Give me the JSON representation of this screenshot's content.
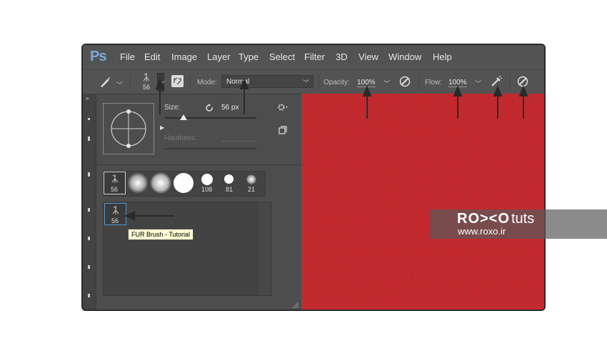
{
  "app": {
    "logo": "Ps"
  },
  "menu": [
    "File",
    "Edit",
    "Image",
    "Layer",
    "Type",
    "Select",
    "Filter",
    "3D",
    "View",
    "Window",
    "Help"
  ],
  "options": {
    "brush_size_preview": "56",
    "mode_label": "Mode:",
    "mode_value": "Normal",
    "opacity_label": "Opacity:",
    "opacity_value": "100%",
    "flow_label": "Flow:",
    "flow_value": "100%"
  },
  "brush_panel": {
    "size_label": "Size:",
    "size_value": "56 px",
    "hardness_label": "Hardness:",
    "size_slider_percent": 20,
    "presets": [
      {
        "label": "56",
        "kind": "fur"
      },
      {
        "label": "",
        "kind": "soft"
      },
      {
        "label": "",
        "kind": "soft"
      },
      {
        "label": "",
        "kind": "hard"
      },
      {
        "label": "108",
        "kind": "hard-small"
      },
      {
        "label": "81",
        "kind": "hard-small"
      },
      {
        "label": "21",
        "kind": "soft-small"
      }
    ],
    "selected_brush_label": "56",
    "tooltip": "FUR Brush - Tutorial"
  },
  "watermark": {
    "brand": "RO><O",
    "suffix": "tuts",
    "url": "www.roxo.ir"
  },
  "colors": {
    "canvas": "#c3282c",
    "ui_bg": "#535353",
    "accent": "#7aa9d6"
  }
}
